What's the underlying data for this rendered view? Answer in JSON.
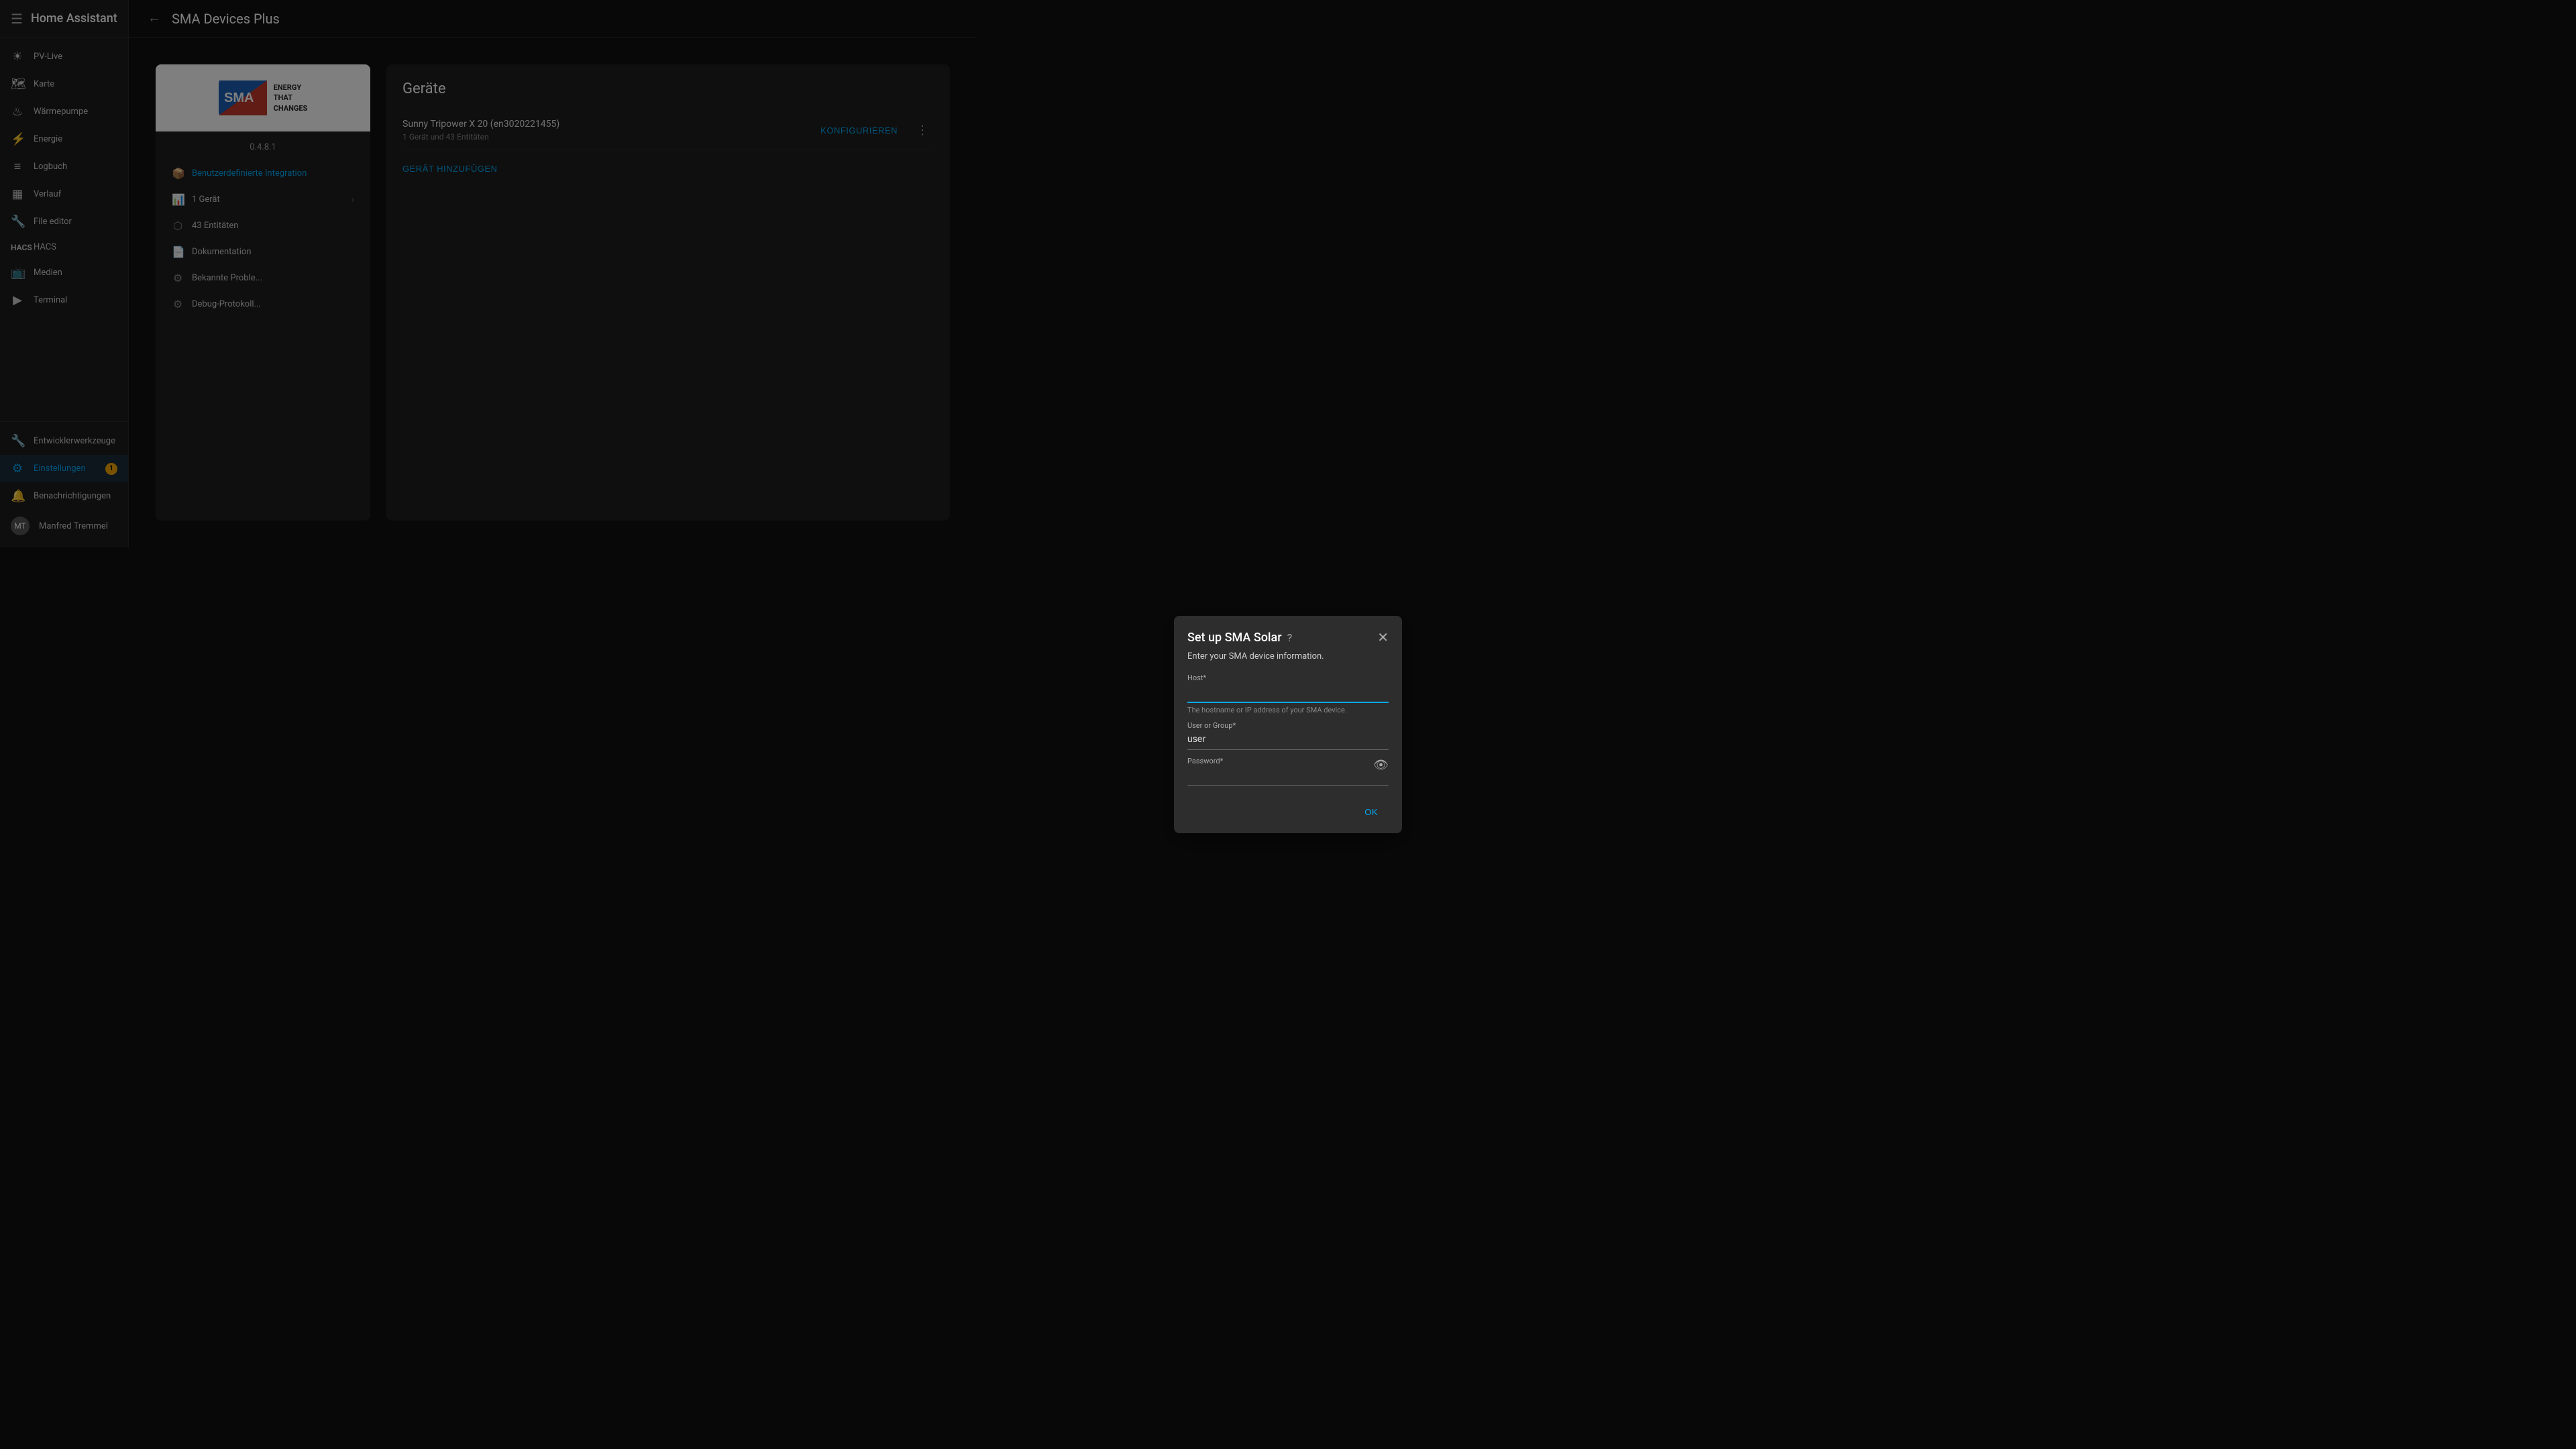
{
  "app": {
    "title": "Home Assistant",
    "page_title": "SMA Devices Plus"
  },
  "sidebar": {
    "items": [
      {
        "id": "pv-live",
        "label": "PV-Live",
        "icon": "☀"
      },
      {
        "id": "karte",
        "label": "Karte",
        "icon": "🗺"
      },
      {
        "id": "waermepumpe",
        "label": "Wärmepumpe",
        "icon": "🌡"
      },
      {
        "id": "energie",
        "label": "Energie",
        "icon": "⚡"
      },
      {
        "id": "logbuch",
        "label": "Logbuch",
        "icon": "☰"
      },
      {
        "id": "verlauf",
        "label": "Verlauf",
        "icon": "📊"
      },
      {
        "id": "file-editor",
        "label": "File editor",
        "icon": "🛠"
      },
      {
        "id": "hacs",
        "label": "HACS",
        "icon": "H"
      },
      {
        "id": "medien",
        "label": "Medien",
        "icon": "📺"
      },
      {
        "id": "terminal",
        "label": "Terminal",
        "icon": ">"
      }
    ],
    "footer": [
      {
        "id": "entwicklerwerkzeuge",
        "label": "Entwicklerwerkzeuge",
        "icon": "🔧"
      },
      {
        "id": "einstellungen",
        "label": "Einstellungen",
        "icon": "⚙",
        "active": true,
        "badge": "1"
      }
    ],
    "user": {
      "name": "Manfred Tremmel",
      "initials": "MT"
    },
    "notification": {
      "label": "Benachrichtigungen",
      "icon": "🔔"
    }
  },
  "integration": {
    "version": "0.4.8.1",
    "logo_top_text": "SMA",
    "logo_bottom_text": "ENERGY\nTHAT\nCHANGES",
    "menu_items": [
      {
        "id": "benutzerdefinierte",
        "label": "Benutzerdefinierte Integration",
        "icon": "box",
        "highlighted": true
      },
      {
        "id": "geraet",
        "label": "1 Gerät",
        "icon": "chart",
        "has_chevron": true
      },
      {
        "id": "entitaeten",
        "label": "43 Entitäten",
        "icon": "nodes",
        "has_chevron": false
      },
      {
        "id": "dokumentation",
        "label": "Dokumentation",
        "icon": "doc",
        "has_chevron": false
      },
      {
        "id": "bekannte-probleme",
        "label": "Bekannte Proble...",
        "icon": "gear",
        "has_chevron": false
      },
      {
        "id": "debug-protokoll",
        "label": "Debug-Protokoll...",
        "icon": "gear2",
        "has_chevron": false
      }
    ]
  },
  "devices_section": {
    "title": "Geräte",
    "device": {
      "name": "Sunny Tripower X 20 (en3020221455)",
      "geraet_count": "1 Gerät",
      "und": "und",
      "entitaeten_count": "43 Entitäten"
    },
    "configure_label": "KONFIGURIEREN",
    "add_device_label": "GERÄT HINZUFÜGEN"
  },
  "dialog": {
    "title": "Set up SMA Solar",
    "subtitle": "Enter your SMA device information.",
    "fields": [
      {
        "id": "host",
        "label": "Host*",
        "value": "",
        "hint": "The hostname or IP address of your SMA device.",
        "type": "text",
        "has_eye": false
      },
      {
        "id": "user-group",
        "label": "User or Group*",
        "value": "user",
        "hint": "",
        "type": "text",
        "has_eye": false
      },
      {
        "id": "password",
        "label": "Password*",
        "value": "",
        "hint": "",
        "type": "password",
        "has_eye": true
      }
    ],
    "ok_label": "OK"
  }
}
